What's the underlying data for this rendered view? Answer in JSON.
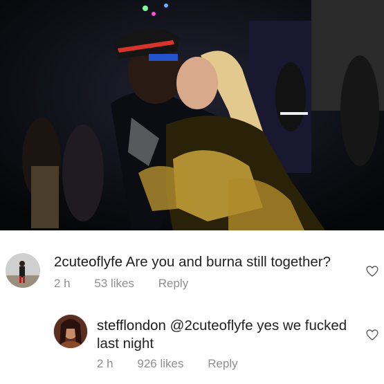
{
  "photo": {
    "icon": "party-photo-couple-kissing"
  },
  "comments": [
    {
      "username": "2cuteoflyfe",
      "text": "Are you and burna still together?",
      "time": "2 h",
      "likes": "53 likes",
      "reply_label": "Reply",
      "avatar_icon": "user-avatar-icon",
      "like_icon": "heart-outline-icon"
    },
    {
      "username": "stefflondon",
      "text_first": "@2cuteoflyfe",
      "text_second": " yes we fucked last night",
      "time": "2 h",
      "likes": "926 likes",
      "reply_label": "Reply",
      "avatar_icon": "user-avatar-icon",
      "like_icon": "heart-outline-icon"
    }
  ],
  "colors": {
    "text_primary": "#222222",
    "text_meta": "#8e8e8e",
    "background": "#ffffff"
  }
}
